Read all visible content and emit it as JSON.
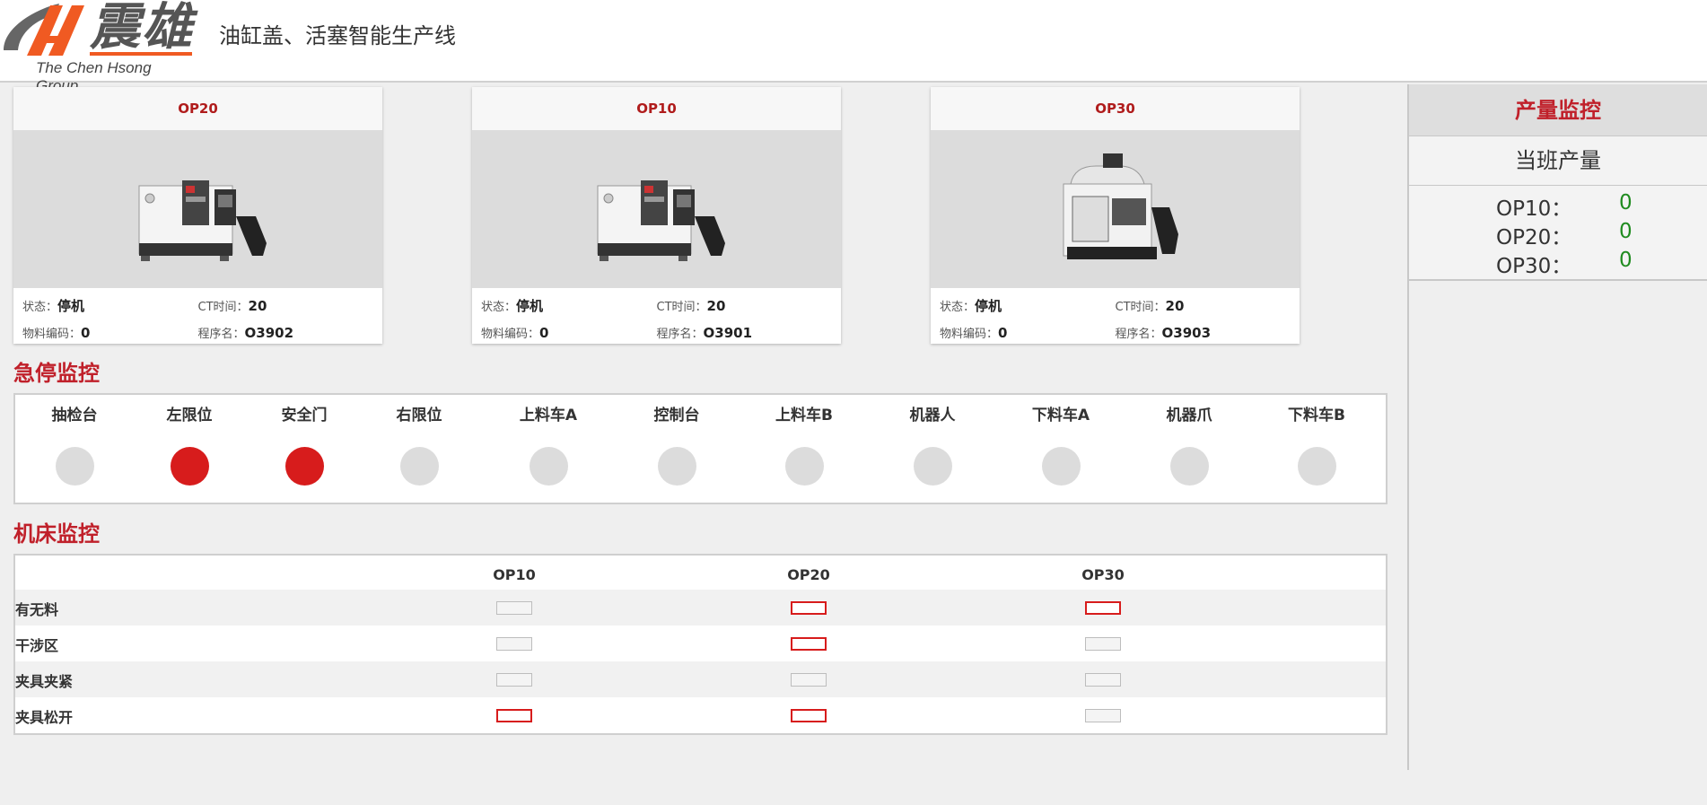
{
  "header": {
    "logo_name": "震雄",
    "logo_sub": "The Chen Hsong Group",
    "title": "油缸盖、活塞智能生产线"
  },
  "colors": {
    "accent_red": "#c0202a",
    "alarm_red": "#d71c1c",
    "ok_green": "#1f8b1f",
    "logo_orange": "#f05a22"
  },
  "cards": [
    {
      "title": "OP20",
      "status_label": "状态：",
      "status": "停机",
      "ct_label": "CT时间：",
      "ct": "20",
      "code_label": "物料编码：",
      "code": "0",
      "prog_label": "程序名：",
      "prog": "O3902",
      "image": "lathe-machine"
    },
    {
      "title": "OP10",
      "status_label": "状态：",
      "status": "停机",
      "ct_label": "CT时间：",
      "ct": "20",
      "code_label": "物料编码：",
      "code": "0",
      "prog_label": "程序名：",
      "prog": "O3901",
      "image": "lathe-machine"
    },
    {
      "title": "OP30",
      "status_label": "状态：",
      "status": "停机",
      "ct_label": "CT时间：",
      "ct": "20",
      "code_label": "物料编码：",
      "code": "0",
      "prog_label": "程序名：",
      "prog": "O3903",
      "image": "machining-center"
    }
  ],
  "estop": {
    "title": "急停监控",
    "items": [
      {
        "label": "抽检台",
        "active": false
      },
      {
        "label": "左限位",
        "active": true
      },
      {
        "label": "安全门",
        "active": true
      },
      {
        "label": "右限位",
        "active": false
      },
      {
        "label": "上料车A",
        "active": false
      },
      {
        "label": "控制台",
        "active": false
      },
      {
        "label": "上料车B",
        "active": false
      },
      {
        "label": "机器人",
        "active": false
      },
      {
        "label": "下料车A",
        "active": false
      },
      {
        "label": "机器爪",
        "active": false
      },
      {
        "label": "下料车B",
        "active": false
      }
    ]
  },
  "machine": {
    "title": "机床监控",
    "columns": [
      "OP10",
      "OP20",
      "OP30"
    ],
    "rows": [
      {
        "label": "有无料",
        "states": [
          false,
          true,
          true
        ]
      },
      {
        "label": "干涉区",
        "states": [
          false,
          true,
          false
        ]
      },
      {
        "label": "夹具夹紧",
        "states": [
          false,
          false,
          false
        ]
      },
      {
        "label": "夹具松开",
        "states": [
          true,
          true,
          false
        ]
      }
    ]
  },
  "production": {
    "title": "产量监控",
    "subtitle": "当班产量",
    "items": [
      {
        "name": "OP10：",
        "value": "0"
      },
      {
        "name": "OP20：",
        "value": "0"
      },
      {
        "name": "OP30：",
        "value": "0"
      }
    ]
  }
}
